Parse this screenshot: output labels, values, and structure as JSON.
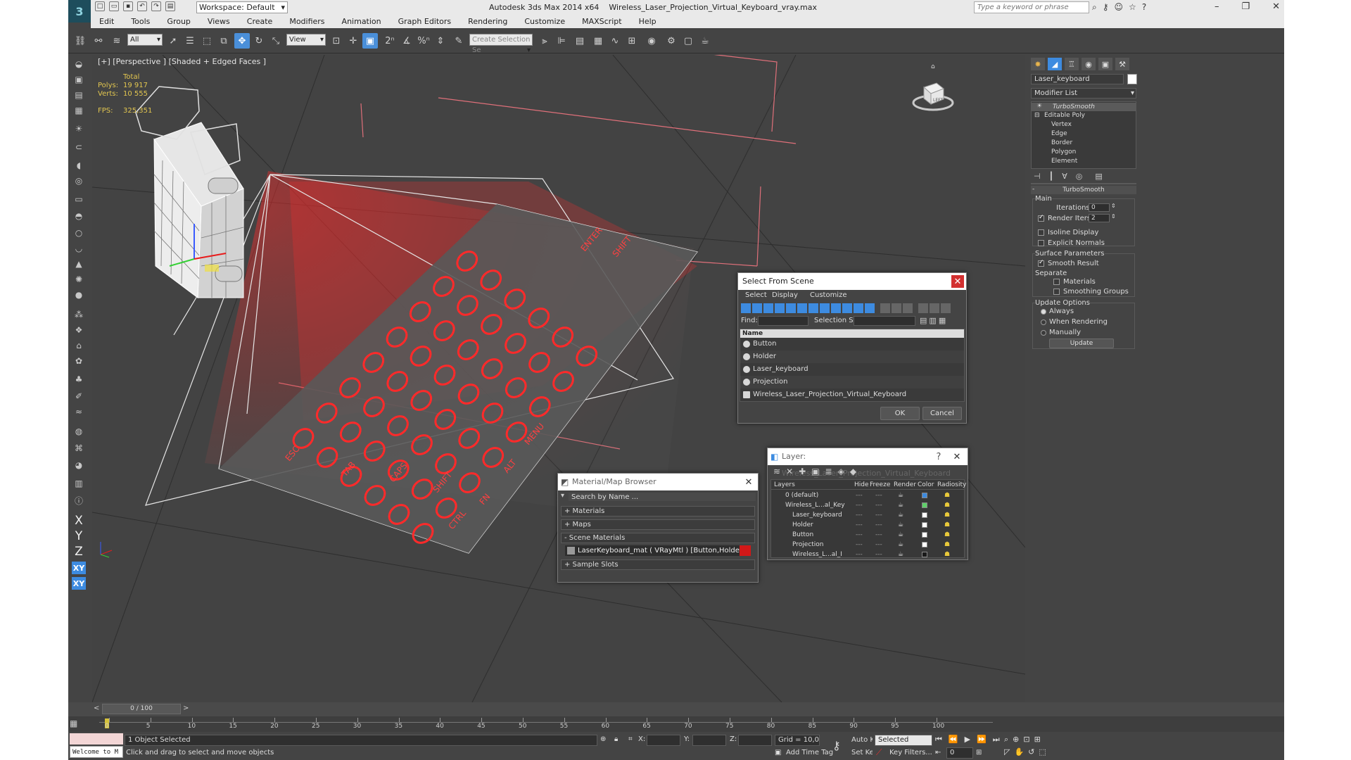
{
  "app": {
    "title": "Autodesk 3ds Max  2014 x64",
    "file": "Wireless_Laser_Projection_Virtual_Keyboard_vray.max",
    "workspace": "Workspace: Default",
    "search_placeholder": "Type a keyword or phrase"
  },
  "menu": [
    "Edit",
    "Tools",
    "Group",
    "Views",
    "Create",
    "Modifiers",
    "Animation",
    "Graph Editors",
    "Rendering",
    "Customize",
    "MAXScript",
    "Help"
  ],
  "toolbar": {
    "filter_value": "All",
    "refcoord_value": "View",
    "selection_set_placeholder": "Create Selection Se"
  },
  "viewport": {
    "label": "[+] [Perspective ] [Shaded + Edged Faces ]",
    "stats": {
      "total_label": "Total",
      "polys_label": "Polys:",
      "polys_value": "19 917",
      "verts_label": "Verts:",
      "verts_value": "10 555",
      "fps_label": "FPS:",
      "fps_value": "325,351"
    },
    "viewcube_label": "LEFT",
    "keys": [
      "ESC",
      "TAB",
      "CAPS",
      "SHIFT",
      "CTRL",
      "FN",
      "ALT",
      "MENU",
      "ENTER",
      "SHIFT"
    ]
  },
  "command_panel": {
    "object_name": "Laser_keyboard",
    "object_color": "#ffffff",
    "modifier_list": "Modifier List",
    "stack": [
      "TurboSmooth",
      "Editable Poly",
      "Vertex",
      "Edge",
      "Border",
      "Polygon",
      "Element"
    ],
    "rollout_title": "TurboSmooth",
    "main_label": "Main",
    "iterations_label": "Iterations:",
    "iterations_value": "0",
    "render_iters_label": "Render Iters:",
    "render_iters_value": "2",
    "isoline_label": "Isoline Display",
    "explicit_label": "Explicit Normals",
    "surface_label": "Surface Parameters",
    "smooth_result_label": "Smooth Result",
    "separate_label": "Separate",
    "materials_label": "Materials",
    "smoothing_groups_label": "Smoothing Groups",
    "update_options_label": "Update Options",
    "always_label": "Always",
    "when_rendering_label": "When Rendering",
    "manually_label": "Manually",
    "update_button": "Update"
  },
  "select_dialog": {
    "title": "Select From Scene",
    "tabs": [
      "Select",
      "Display",
      "Customize"
    ],
    "find_label": "Find:",
    "selection_set_label": "Selection Set:",
    "column_name": "Name",
    "items": [
      "Button",
      "Holder",
      "Laser_keyboard",
      "Projection",
      "Wireless_Laser_Projection_Virtual_Keyboard"
    ],
    "ok": "OK",
    "cancel": "Cancel"
  },
  "layer_dialog": {
    "title": "Layer: Wireless_Laser_Projection_Virtual_Keyboard",
    "columns": [
      "Layers",
      "Hide",
      "Freeze",
      "Render",
      "Color",
      "Radiosity"
    ],
    "rows": [
      {
        "name": "0 (default)",
        "color": "#3d8be0"
      },
      {
        "name": "Wireless_L...al_Key",
        "color": "#5fd06a"
      },
      {
        "name": "Laser_keyboard",
        "color": "#ffffff"
      },
      {
        "name": "Holder",
        "color": "#ffffff"
      },
      {
        "name": "Button",
        "color": "#ffffff"
      },
      {
        "name": "Projection",
        "color": "#ffffff"
      },
      {
        "name": "Wireless_L...al_I",
        "color": "#1a1a1a"
      }
    ]
  },
  "material_browser": {
    "title": "Material/Map Browser",
    "search_placeholder": "Search by Name ...",
    "sections": [
      "+ Materials",
      "+ Maps",
      "- Scene Materials",
      "+ Sample Slots"
    ],
    "scene_material": "LaserKeyboard_mat  ( VRayMtl ) [Button,Holder,Laser_keyboa..."
  },
  "timeline": {
    "frame_display": "0 / 100",
    "ticks": [
      "0",
      "5",
      "10",
      "15",
      "20",
      "25",
      "30",
      "35",
      "40",
      "45",
      "50",
      "55",
      "60",
      "65",
      "70",
      "75",
      "80",
      "85",
      "90",
      "95",
      "100"
    ]
  },
  "status": {
    "maxscript": "Welcome to M",
    "selected": "1 Object Selected",
    "prompt": "Click and drag to select and move objects",
    "x_label": "X:",
    "y_label": "Y:",
    "z_label": "Z:",
    "grid": "Grid = 10,0cm",
    "add_time_tag": "Add Time Tag",
    "auto_key": "Auto Key",
    "set_key": "Set Key",
    "selected_dropdown": "Selected",
    "key_filters": "Key Filters...",
    "frame": "0"
  }
}
